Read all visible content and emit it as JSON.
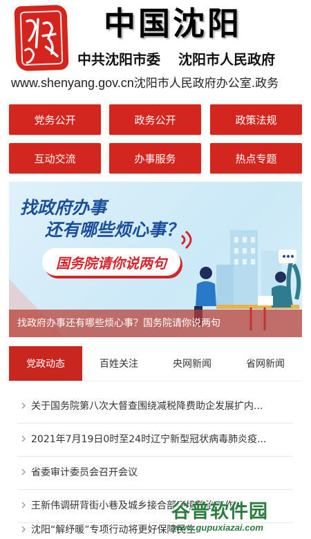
{
  "header": {
    "seal_text": "沈阳",
    "title": "中国沈阳",
    "subtitle_left": "中共沈阳市委",
    "subtitle_right": "沈阳市人民政府",
    "url": "www.shenyang.gov.cn",
    "office": "沈阳市人民政府办公室.政务"
  },
  "nav": {
    "items": [
      {
        "label": "党务公开"
      },
      {
        "label": "政务公开"
      },
      {
        "label": "政策法规"
      },
      {
        "label": "互动交流"
      },
      {
        "label": "办事服务"
      },
      {
        "label": "热点专题"
      }
    ],
    "color": "#d2261f"
  },
  "banner": {
    "headline_1": "找政府办事",
    "headline_2": "还有哪些烦心事？",
    "pill_text": "国务院请你说两句",
    "caption": "找政府办事还有哪些烦心事？国务院请你说两句"
  },
  "tabs": {
    "items": [
      {
        "label": "党政动态",
        "active": true
      },
      {
        "label": "百姓关注",
        "active": false
      },
      {
        "label": "央网新闻",
        "active": false
      },
      {
        "label": "省网新闻",
        "active": false
      }
    ],
    "active_color": "#c9261f"
  },
  "news": {
    "items": [
      {
        "title": "关于国务院第八次大督查围绕减税降费助企发展扩内..."
      },
      {
        "title": "2021年7月19日0时至24时辽宁新型冠状病毒肺炎疫..."
      },
      {
        "title": "省委审计委员会召开会议"
      },
      {
        "title": "王新伟调研背街小巷及城乡接合部环境整治工作"
      },
      {
        "title": "沈阳“解纾暖”专项行动将更好保障民生"
      }
    ]
  },
  "watermark": {
    "text": "谷普软件园",
    "url": "www.gupuxiazai.com"
  }
}
